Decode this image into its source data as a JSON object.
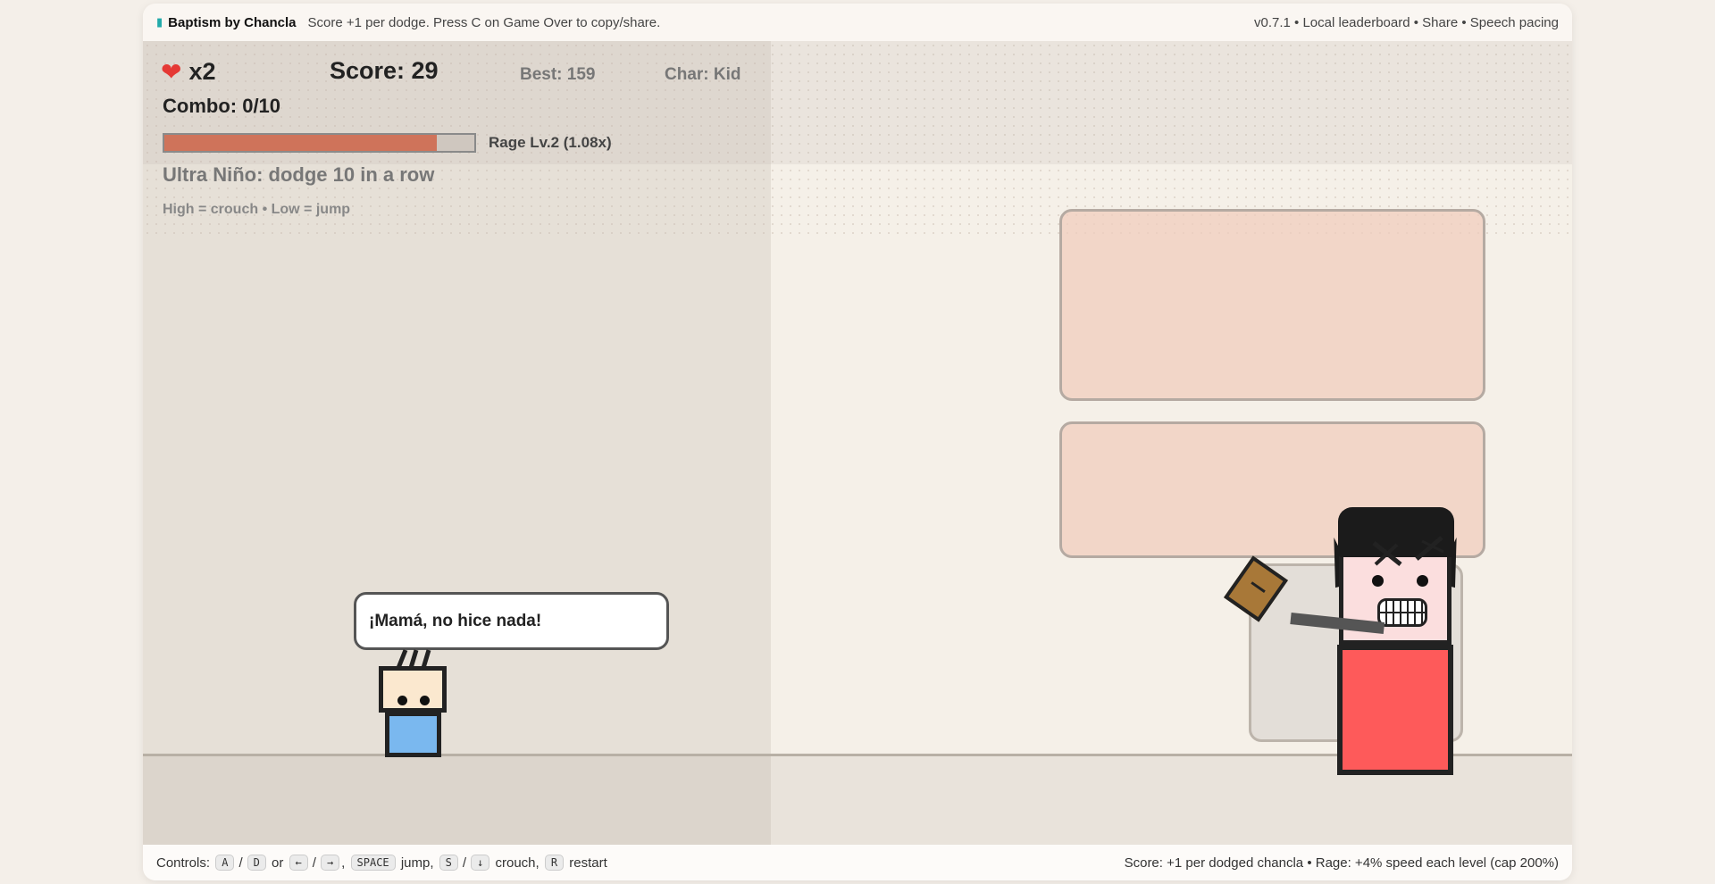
{
  "topbar": {
    "logo_icon": "flip-flop-icon",
    "title": "Baptism by Chancla",
    "subtitle": "Score +1 per dodge. Press C on Game Over to copy/share.",
    "right_text": "v0.7.1 • Local leaderboard • Share • Speech pacing"
  },
  "hud": {
    "lives_icon": "heart-icon",
    "lives": "x2",
    "score": "Score: 29",
    "best": "Best: 159",
    "character": "Char: Kid",
    "combo": "Combo: 0/10",
    "rage_fraction": 0.88,
    "rage_label": "Rage Lv.2 (1.08x)",
    "ultra": "Ultra Niño: dodge 10 in a row",
    "hint": "High = crouch • Low = jump"
  },
  "speech": {
    "kid_line": "¡Mamá, no hice nada!"
  },
  "colors": {
    "rage_fill": "#cf735a",
    "kid_shirt": "#7ab8ef",
    "mom_dress": "#fe5a5a",
    "chancla": "#a87838",
    "panel": "#f0cdbe"
  },
  "footer": {
    "controls_label": "Controls:",
    "key_a": "A",
    "slash1": "/",
    "key_d": "D",
    "or": "or",
    "key_left": "←",
    "slash2": "/",
    "key_right": "→",
    "comma1": ",",
    "key_space": "SPACE",
    "jump": "jump,",
    "key_s": "S",
    "slash3": "/",
    "key_down": "↓",
    "crouch": "crouch,",
    "key_r": "R",
    "restart": "restart",
    "right_text": "Score: +1 per dodged chancla • Rage: +4% speed each level (cap 200%)"
  }
}
